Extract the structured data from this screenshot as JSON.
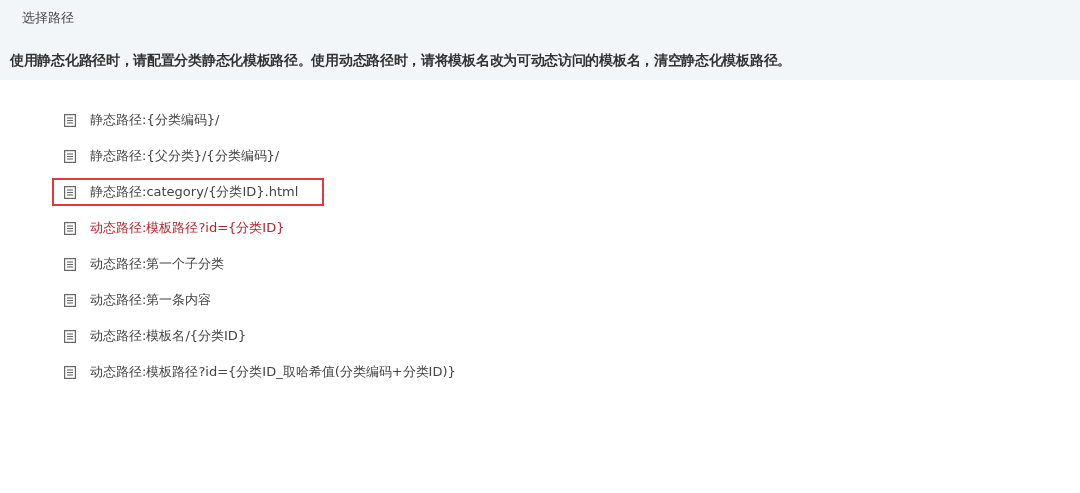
{
  "panel": {
    "title": "选择路径",
    "notice": "使用静态化路径时，请配置分类静态化模板路径。使用动态路径时，请将模板名改为可动态访问的模板名，清空静态化模板路径。"
  },
  "paths": [
    {
      "label": "静态路径:{分类编码}/",
      "selected": false,
      "outlined": false
    },
    {
      "label": "静态路径:{父分类}/{分类编码}/",
      "selected": false,
      "outlined": false
    },
    {
      "label": "静态路径:category/{分类ID}.html",
      "selected": false,
      "outlined": true
    },
    {
      "label": "动态路径:模板路径?id={分类ID}",
      "selected": true,
      "outlined": false
    },
    {
      "label": "动态路径:第一个子分类",
      "selected": false,
      "outlined": false
    },
    {
      "label": "动态路径:第一条内容",
      "selected": false,
      "outlined": false
    },
    {
      "label": "动态路径:模板名/{分类ID}",
      "selected": false,
      "outlined": false
    },
    {
      "label": "动态路径:模板路径?id={分类ID_取哈希值(分类编码+分类ID)}",
      "selected": false,
      "outlined": false
    }
  ]
}
